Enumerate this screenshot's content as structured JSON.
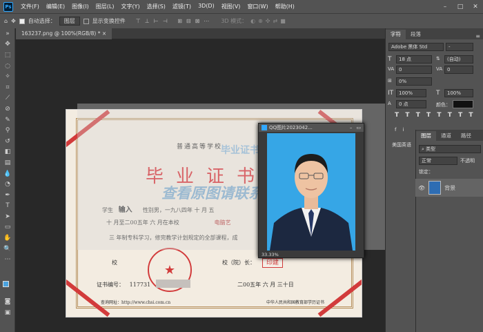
{
  "app": {
    "logo": "Ps"
  },
  "menu": [
    "文件(F)",
    "编辑(E)",
    "图像(I)",
    "图层(L)",
    "文字(Y)",
    "选择(S)",
    "滤镜(T)",
    "3D(D)",
    "视图(V)",
    "窗口(W)",
    "帮助(H)"
  ],
  "window_controls": [
    "–",
    "□",
    "✕"
  ],
  "options": {
    "auto_select_label": "自动选择：",
    "auto_select_value": "图层",
    "show_transform_label": "显示变换控件",
    "mode_label": "3D 模式："
  },
  "document": {
    "tab_title": "163237.png @ 100%(RGB/8) *",
    "tab_close": "×"
  },
  "certificate": {
    "header": "普通高等学校",
    "title": "毕业证书",
    "line1_a": "学生",
    "name": "输入",
    "line1_b": "性别男，一九八四年 十 月 五",
    "line2": "十 月至二00五年 六 月在本校",
    "major": "电脑艺",
    "line3": "三 年制专科学习，修完教学计划规定的全部课程，成",
    "school_label": "校",
    "president_label": "校（院）长：",
    "cert_no_label": "证书编号：",
    "cert_no": "117731",
    "date": "二00五年 六 月 三十日",
    "footer_left": "查询网址：http://www.chsi.com.cn",
    "footer_right": "中华人民共和国教育部学历证书",
    "stamp": "印建"
  },
  "watermark": {
    "top": "毕业证书网",
    "center": "查看原图请联系客服"
  },
  "photo_window": {
    "title": "QQ图片2023042...",
    "zoom": "33.33%"
  },
  "char_panel": {
    "tabs": [
      "字符",
      "段落"
    ],
    "font_family": "Adobe 黑体 Std",
    "font_style": "-",
    "font_size": "18 点",
    "leading": "(自动)",
    "kerning": "0",
    "tracking": "0",
    "scale_pct": "0%",
    "vscale": "100%",
    "hscale": "100%",
    "baseline": "0 点",
    "color_label": "颜色：",
    "lang": "美国英语"
  },
  "layers_panel": {
    "tabs": [
      "图层",
      "通道",
      "路径"
    ],
    "kind": "类型",
    "blend": "正常",
    "opacity": "不透明",
    "lock": "锁定：",
    "layer_name": "背景"
  },
  "colors": {
    "accent": "#31a8ff",
    "panel": "#535353",
    "seal": "#d23b3b"
  }
}
